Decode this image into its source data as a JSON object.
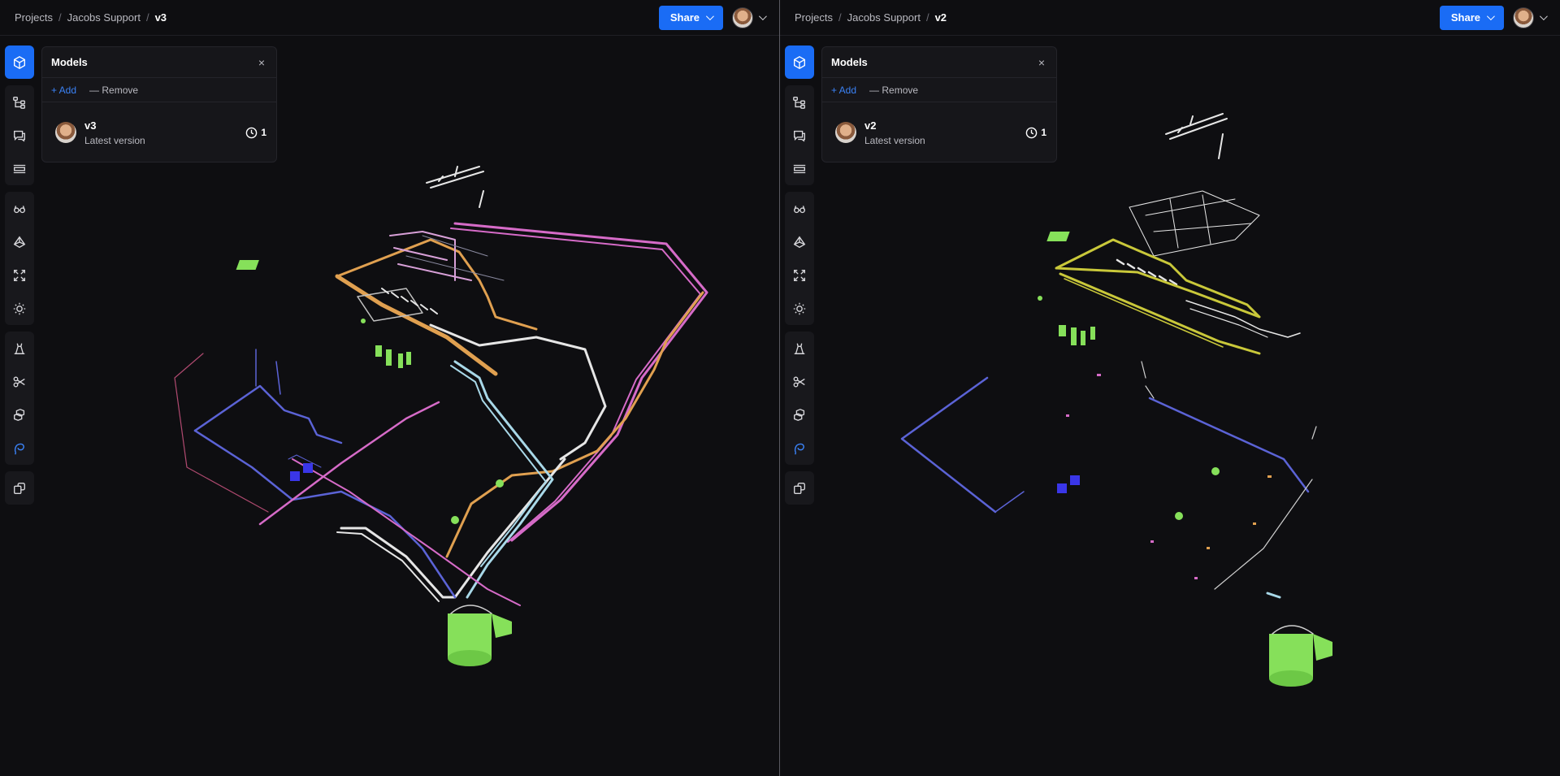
{
  "left": {
    "breadcrumb": [
      "Projects",
      "Jacobs Support",
      "v3"
    ],
    "share_label": "Share",
    "panel": {
      "title": "Models",
      "close": "×",
      "add_label": "+ Add",
      "remove_label": "— Remove",
      "model": {
        "name": "v3",
        "subtitle": "Latest version",
        "versions": "1"
      }
    }
  },
  "right": {
    "breadcrumb": [
      "Projects",
      "Jacobs Support",
      "v2"
    ],
    "share_label": "Share",
    "panel": {
      "title": "Models",
      "close": "×",
      "add_label": "+ Add",
      "remove_label": "— Remove",
      "model": {
        "name": "v2",
        "subtitle": "Latest version",
        "versions": "1"
      }
    }
  },
  "toolbar_icons": {
    "group1": [
      "models-cube-icon"
    ],
    "group2": [
      "scene-tree-icon",
      "comments-icon",
      "sections-icon"
    ],
    "group3": [
      "view-modes-icon",
      "filters-icon",
      "fit-view-icon",
      "light-icon"
    ],
    "group4": [
      "measure-icon",
      "cut-icon",
      "explode-icon",
      "lasso-icon"
    ],
    "group5": [
      "isolate-icon"
    ]
  },
  "colors": {
    "accent": "#1a6cf5",
    "pipe_pink": "#d66bc8",
    "pipe_orange": "#e0a050",
    "pipe_blue": "#5b63d6",
    "pipe_white": "#e6e6e6",
    "pipe_cyan": "#a8d8e8",
    "equipment_green": "#86e05a",
    "pump_blue": "#3a36e8",
    "yellow_rack": "#c9c83a"
  }
}
